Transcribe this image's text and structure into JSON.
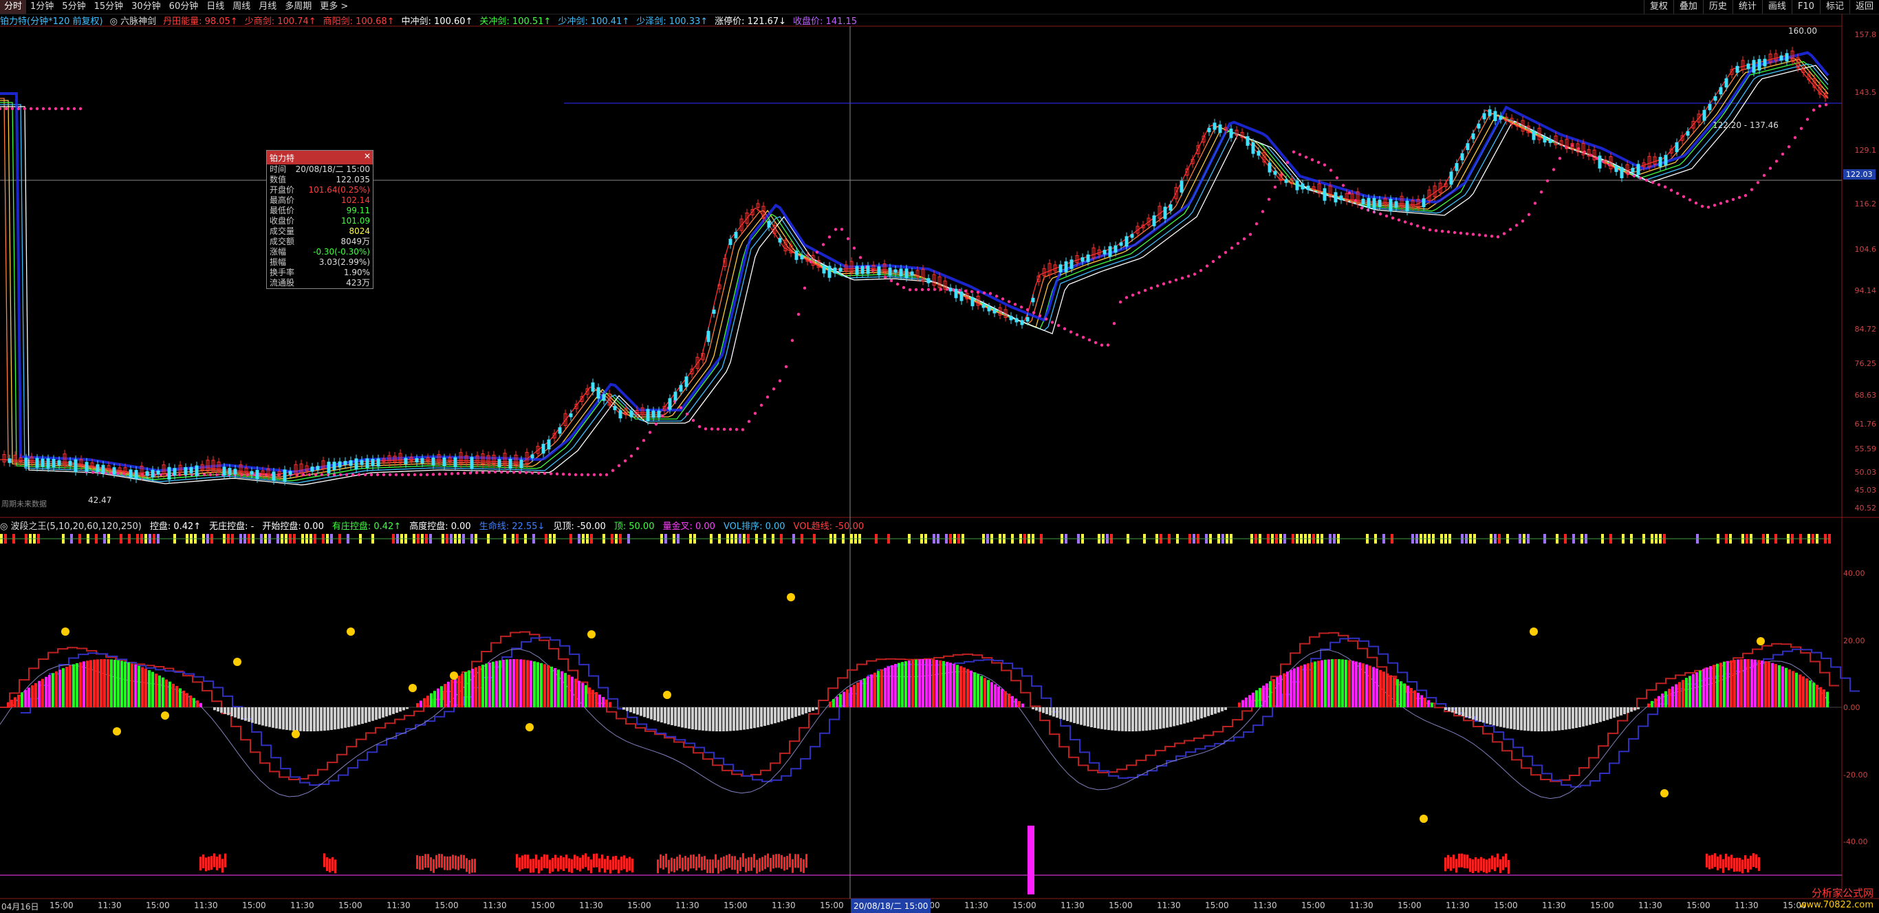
{
  "toolbar": {
    "items": [
      "分时",
      "1分钟",
      "5分钟",
      "15分钟",
      "30分钟",
      "60分钟",
      "日线",
      "周线",
      "月线",
      "多周期",
      "更多 >"
    ],
    "active_index": 0,
    "right_buttons": [
      "复权",
      "叠加",
      "历史",
      "统计",
      "画线",
      "F10",
      "标记",
      "返回"
    ]
  },
  "infobar": {
    "title": "铂力特(分钟*120 前复权)",
    "indicator": "◎ 六脉神剑",
    "items": [
      {
        "label": "丹田能量: 98.05↑",
        "color": "#ff4040"
      },
      {
        "label": "少商剑: 100.74↑",
        "color": "#ff4040"
      },
      {
        "label": "商阳剑: 100.68↑",
        "color": "#ff4040"
      },
      {
        "label": "中冲剑: 100.60↑",
        "color": "#ffffff"
      },
      {
        "label": "关冲剑: 100.51↑",
        "color": "#40ff40"
      },
      {
        "label": "少冲剑: 100.41↑",
        "color": "#40c0ff"
      },
      {
        "label": "少泽剑: 100.33↑",
        "color": "#40c0ff"
      },
      {
        "label": "涨停价: 121.67↓",
        "color": "#ffffff"
      },
      {
        "label": "收盘价: 141.15",
        "color": "#c060ff"
      }
    ]
  },
  "tooltip": {
    "title": "铂力特",
    "rows": [
      {
        "k": "时间",
        "v": "20/08/18/二 15:00",
        "c": "#dddddd"
      },
      {
        "k": "数值",
        "v": "122.035",
        "c": "#dddddd"
      },
      {
        "k": "开盘价",
        "v": "101.64(0.25%)",
        "c": "#ff4040"
      },
      {
        "k": "最高价",
        "v": "102.14",
        "c": "#ff4040"
      },
      {
        "k": "最低价",
        "v": "99.11",
        "c": "#40ff40"
      },
      {
        "k": "收盘价",
        "v": "101.09",
        "c": "#40ff40"
      },
      {
        "k": "成交量",
        "v": "8024",
        "c": "#ffff40"
      },
      {
        "k": "成交额",
        "v": "8049万",
        "c": "#dddddd"
      },
      {
        "k": "涨幅",
        "v": "-0.30(-0.30%)",
        "c": "#40ff40"
      },
      {
        "k": "振幅",
        "v": "3.03(2.99%)",
        "c": "#dddddd"
      },
      {
        "k": "换手率",
        "v": "1.90%",
        "c": "#dddddd"
      },
      {
        "k": "流通股",
        "v": "423万",
        "c": "#dddddd"
      }
    ]
  },
  "price_axis": {
    "labels": [
      "157.8",
      "143.5",
      "129.1",
      "116.2",
      "104.6",
      "94.14",
      "84.72",
      "76.25",
      "68.63",
      "61.76",
      "55.59",
      "50.03",
      "45.03",
      "40.52"
    ],
    "current_price": "122.03"
  },
  "annotations": {
    "high_label": "160.00",
    "low_label": "42.47",
    "range_label": "122.20 - 137.46",
    "future_note": "周期未来数据"
  },
  "indicator2": {
    "title": "◎ 波段之王(5,10,20,60,120,250)",
    "items": [
      {
        "label": "控盘: 0.42↑",
        "color": "#ffffff"
      },
      {
        "label": "无庄控盘: -",
        "color": "#ffffff"
      },
      {
        "label": "开始控盘: 0.00",
        "color": "#ffffff"
      },
      {
        "label": "有庄控盘: 0.42↑",
        "color": "#40ff40"
      },
      {
        "label": "高度控盘: 0.00",
        "color": "#ffffff"
      },
      {
        "label": "生命线: 22.55↓",
        "color": "#4080ff"
      },
      {
        "label": "见顶: -50.00",
        "color": "#ffffff"
      },
      {
        "label": "顶: 50.00",
        "color": "#40ff40"
      },
      {
        "label": "量金叉: 0.00",
        "color": "#ff40ff"
      },
      {
        "label": "VOL排序: 0.00",
        "color": "#40c0ff"
      },
      {
        "label": "VOL趋线: -50.00",
        "color": "#ff4040"
      }
    ],
    "axis_labels": [
      "40.00",
      "20.00",
      "0.00",
      "-20.00",
      "-40.00"
    ]
  },
  "time_axis": {
    "labels": [
      "04月16日",
      "15:00",
      "11:30",
      "15:00",
      "11:30",
      "15:00",
      "11:30",
      "15:00",
      "11:30",
      "15:00",
      "11:30",
      "15:00",
      "11:30",
      "15:00",
      "11:30",
      "15:00",
      "11:30",
      "15:00",
      "11:30",
      "15:00",
      "11:30",
      "15:00",
      "11:30",
      "15:00",
      "11:30",
      "15:00",
      "11:30",
      "15:00",
      "11:30",
      "15:00",
      "11:30",
      "15:00",
      "11:30",
      "15:00",
      "11:30",
      "15:00",
      "11:30",
      "15:00"
    ],
    "cursor_date": "20/08/18/二 15:00"
  },
  "watermark": {
    "name": "分析家公式网",
    "url": "www.70822.com"
  },
  "colors": {
    "up": "#ff3030",
    "down": "#40e0ff",
    "ma_dots": "#ff3399",
    "blue_band": "#2030ff"
  }
}
